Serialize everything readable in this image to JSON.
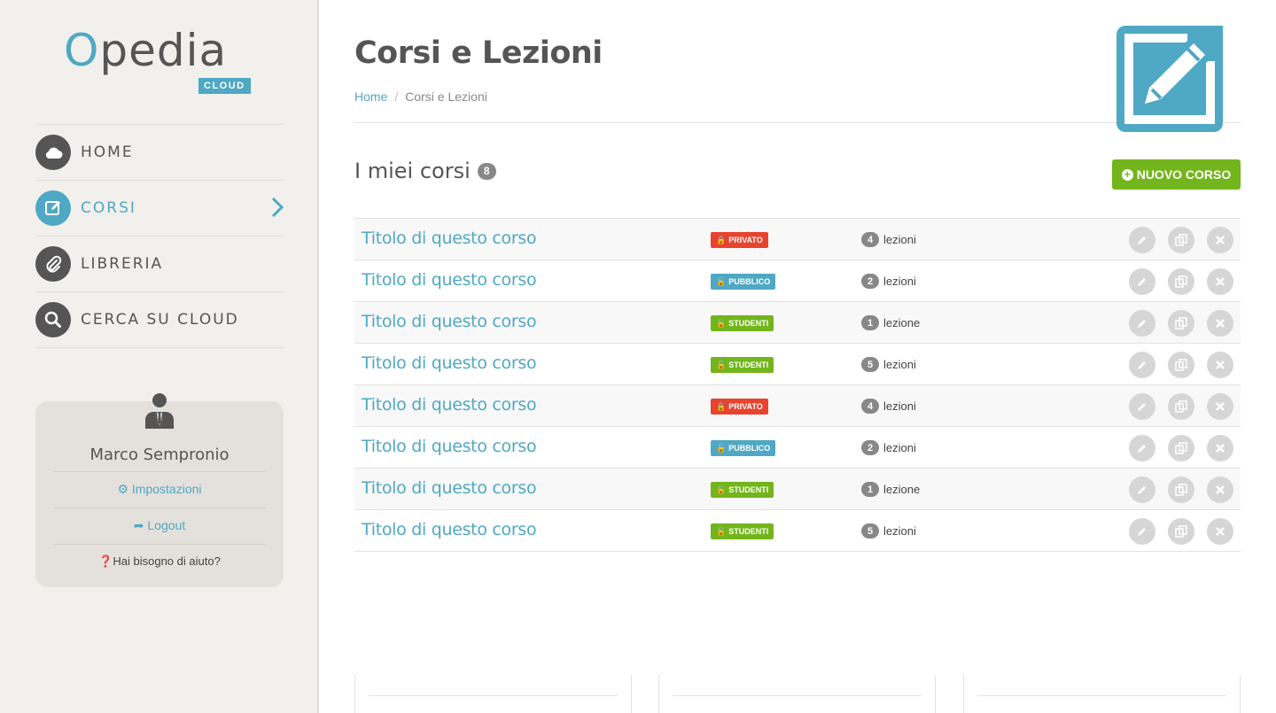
{
  "brand": {
    "name_o": "O",
    "name_rest": "pedia",
    "tag": "CLOUD",
    "accent": "#4fa8c4",
    "dark": "#555555"
  },
  "nav": [
    {
      "label": "HOME",
      "icon": "cloud-icon",
      "active": false
    },
    {
      "label": "CORSI",
      "icon": "edit-icon",
      "active": true
    },
    {
      "label": "LIBRERIA",
      "icon": "paperclip-icon",
      "active": false
    },
    {
      "label": "CERCA SU CLOUD",
      "icon": "search-icon",
      "active": false
    }
  ],
  "user": {
    "name": "Marco Sempronio",
    "settings": "Impostazioni",
    "logout": "Logout",
    "help": "Hai bisogno di aiuto?"
  },
  "page": {
    "title": "Corsi e Lezioni",
    "breadcrumb": {
      "home": "Home",
      "sep": "/",
      "current": "Corsi e Lezioni"
    }
  },
  "courses_section": {
    "title": "I miei corsi",
    "count": "8",
    "new_button": "NUOVO CORSO"
  },
  "status_colors": {
    "PRIVATO": "#e8432e",
    "PUBBLICO": "#4fa8c4",
    "STUDENTI": "#73b51c"
  },
  "courses": [
    {
      "title": "Titolo di questo corso",
      "status": "PRIVATO",
      "lessons_count": "4",
      "lessons_label": "lezioni"
    },
    {
      "title": "Titolo di questo corso",
      "status": "PUBBLICO",
      "lessons_count": "2",
      "lessons_label": "lezioni"
    },
    {
      "title": "Titolo di questo corso",
      "status": "STUDENTI",
      "lessons_count": "1",
      "lessons_label": "lezione"
    },
    {
      "title": "Titolo di questo corso",
      "status": "STUDENTI",
      "lessons_count": "5",
      "lessons_label": "lezioni"
    },
    {
      "title": "Titolo di questo corso",
      "status": "PRIVATO",
      "lessons_count": "4",
      "lessons_label": "lezioni"
    },
    {
      "title": "Titolo di questo corso",
      "status": "PUBBLICO",
      "lessons_count": "2",
      "lessons_label": "lezioni"
    },
    {
      "title": "Titolo di questo corso",
      "status": "STUDENTI",
      "lessons_count": "1",
      "lessons_label": "lezione"
    },
    {
      "title": "Titolo di questo corso",
      "status": "STUDENTI",
      "lessons_count": "5",
      "lessons_label": "lezioni"
    }
  ],
  "row_actions": [
    "edit-icon",
    "copy-icon",
    "close-icon"
  ]
}
